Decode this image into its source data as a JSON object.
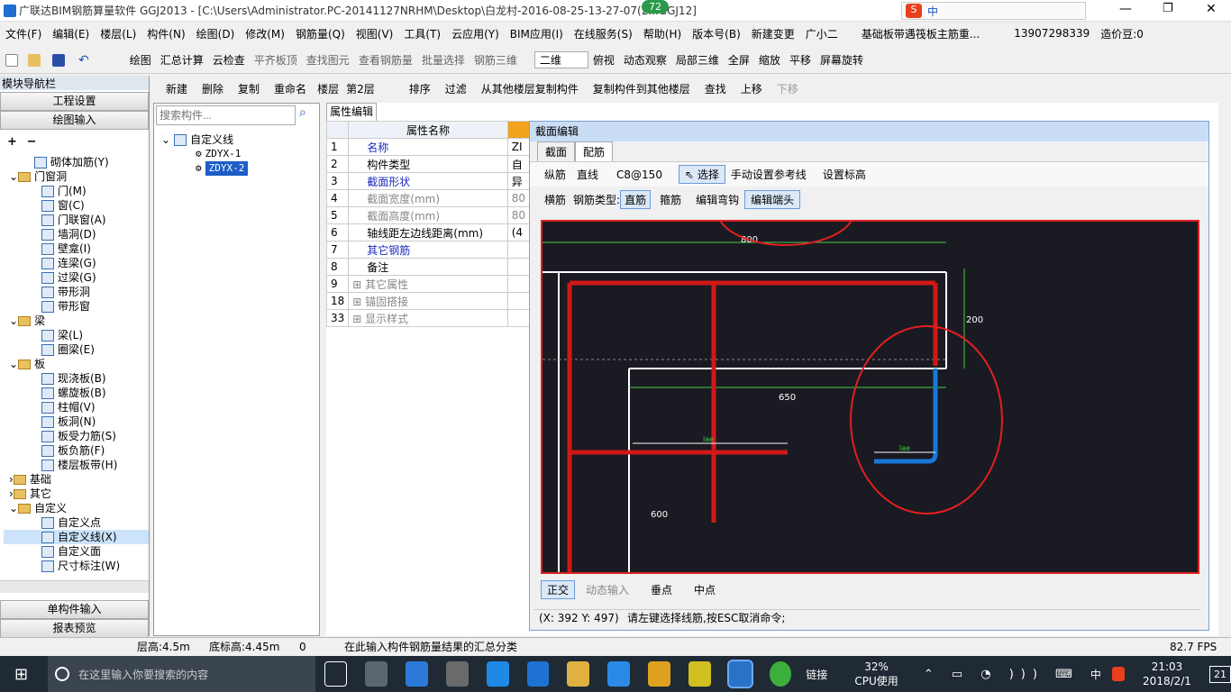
{
  "titlebar": {
    "text": "广联达BIM钢筋算量软件 GGJ2013 - [C:\\Users\\Administrator.PC-20141127NRHM\\Desktop\\白龙村-2016-08-25-13-27-07(2...GGJ12]",
    "badge": "72",
    "ime": "中"
  },
  "menu": [
    "文件(F)",
    "编辑(E)",
    "楼层(L)",
    "构件(N)",
    "绘图(D)",
    "修改(M)",
    "钢筋量(Q)",
    "视图(V)",
    "工具(T)",
    "云应用(Y)",
    "BIM应用(I)",
    "在线服务(S)",
    "帮助(H)",
    "版本号(B)",
    "新建变更",
    "广小二",
    "基础板带遇筏板主筋重...",
    "13907298339",
    "造价豆:0"
  ],
  "toolbar1": [
    "绘图",
    "汇总计算",
    "云检查",
    "平齐板顶",
    "查找图元",
    "查看钢筋量",
    "批量选择",
    "钢筋三维",
    "二维",
    "俯视",
    "动态观察",
    "局部三维",
    "全屏",
    "缩放",
    "平移",
    "屏幕旋转"
  ],
  "nav": {
    "title": "模块导航栏",
    "btn_project": "工程设置",
    "btn_draw": "绘图输入",
    "btn_single": "单构件输入",
    "btn_report": "报表预览",
    "tree": [
      [
        "",
        "砌体加筋(Y)"
      ],
      [
        "f",
        "门窗洞"
      ],
      [
        "",
        "门(M)"
      ],
      [
        "",
        "窗(C)"
      ],
      [
        "",
        "门联窗(A)"
      ],
      [
        "",
        "墙洞(D)"
      ],
      [
        "",
        "壁龛(I)"
      ],
      [
        "",
        "连梁(G)"
      ],
      [
        "",
        "过梁(G)"
      ],
      [
        "",
        "带形洞"
      ],
      [
        "",
        "带形窗"
      ],
      [
        "f",
        "梁"
      ],
      [
        "",
        "梁(L)"
      ],
      [
        "",
        "圈梁(E)"
      ],
      [
        "f",
        "板"
      ],
      [
        "",
        "现浇板(B)"
      ],
      [
        "",
        "螺旋板(B)"
      ],
      [
        "",
        "柱帽(V)"
      ],
      [
        "",
        "板洞(N)"
      ],
      [
        "",
        "板受力筋(S)"
      ],
      [
        "",
        "板负筋(F)"
      ],
      [
        "",
        "楼层板带(H)"
      ],
      [
        "f",
        "基础"
      ],
      [
        "f",
        "其它"
      ],
      [
        "f",
        "自定义"
      ],
      [
        "",
        "自定义点"
      ],
      [
        "",
        "自定义线(X)"
      ],
      [
        "",
        "自定义面"
      ],
      [
        "",
        "尺寸标注(W)"
      ]
    ]
  },
  "toolbar2": [
    "新建",
    "删除",
    "复制",
    "重命名",
    "楼层",
    "第2层",
    "排序",
    "过滤",
    "从其他楼层复制构件",
    "复制构件到其他楼层",
    "查找",
    "上移",
    "下移"
  ],
  "search": {
    "placeholder": "搜索构件..."
  },
  "comp_tree": {
    "root": "自定义线",
    "items": [
      "ZDYX-1",
      "ZDYX-2"
    ]
  },
  "prop": {
    "tab": "属性编辑",
    "header": "属性名称",
    "rows": [
      [
        "1",
        "名称"
      ],
      [
        "2",
        "构件类型"
      ],
      [
        "3",
        "截面形状"
      ],
      [
        "4",
        "截面宽度(mm)"
      ],
      [
        "5",
        "截面高度(mm)"
      ],
      [
        "6",
        "轴线距左边线距离(mm)"
      ],
      [
        "7",
        "其它钢筋"
      ],
      [
        "8",
        "备注"
      ],
      [
        "9",
        "其它属性"
      ],
      [
        "18",
        "锚固搭接"
      ],
      [
        "33",
        "显示样式"
      ]
    ],
    "vals": [
      "ZI",
      "自",
      "异",
      "80",
      "80",
      "(4",
      "",
      "",
      "",
      "",
      ""
    ]
  },
  "dialog": {
    "title": "截面编辑",
    "tabs": [
      "截面",
      "配筋"
    ],
    "row1": [
      "纵筋",
      "直线",
      "C8@150",
      "选择",
      "手动设置参考线",
      "设置标高"
    ],
    "row2": [
      "横筋",
      "钢筋类型:",
      "直筋",
      "箍筋",
      "编辑弯钩",
      "编辑端头"
    ],
    "dims": [
      "800",
      "200",
      "650",
      "600",
      "lae",
      "lae"
    ],
    "bottom": [
      "正交",
      "动态输入",
      "垂点",
      "中点"
    ],
    "coords": "(X: 392 Y: 497)",
    "msg": "请左键选择线筋,按ESC取消命令;"
  },
  "status": {
    "floor_h": "层高:4.5m",
    "base_h": "底标高:4.45m",
    "zero": "0",
    "hint": "在此输入构件钢筋量结果的汇总分类",
    "fps": "82.7 FPS"
  },
  "taskbar": {
    "search": "在这里输入你要搜索的内容",
    "link": "链接",
    "cpu_pct": "32%",
    "cpu_label": "CPU使用",
    "ime": "中",
    "time": "21:03",
    "date": "2018/2/1",
    "notif": "21"
  },
  "colors": {
    "canvas_bg": "#1a1a22",
    "rebar_red": "#d01818",
    "rebar_blue": "#1a78d8",
    "dim_green": "#44cc44",
    "annot": "#e02020"
  }
}
